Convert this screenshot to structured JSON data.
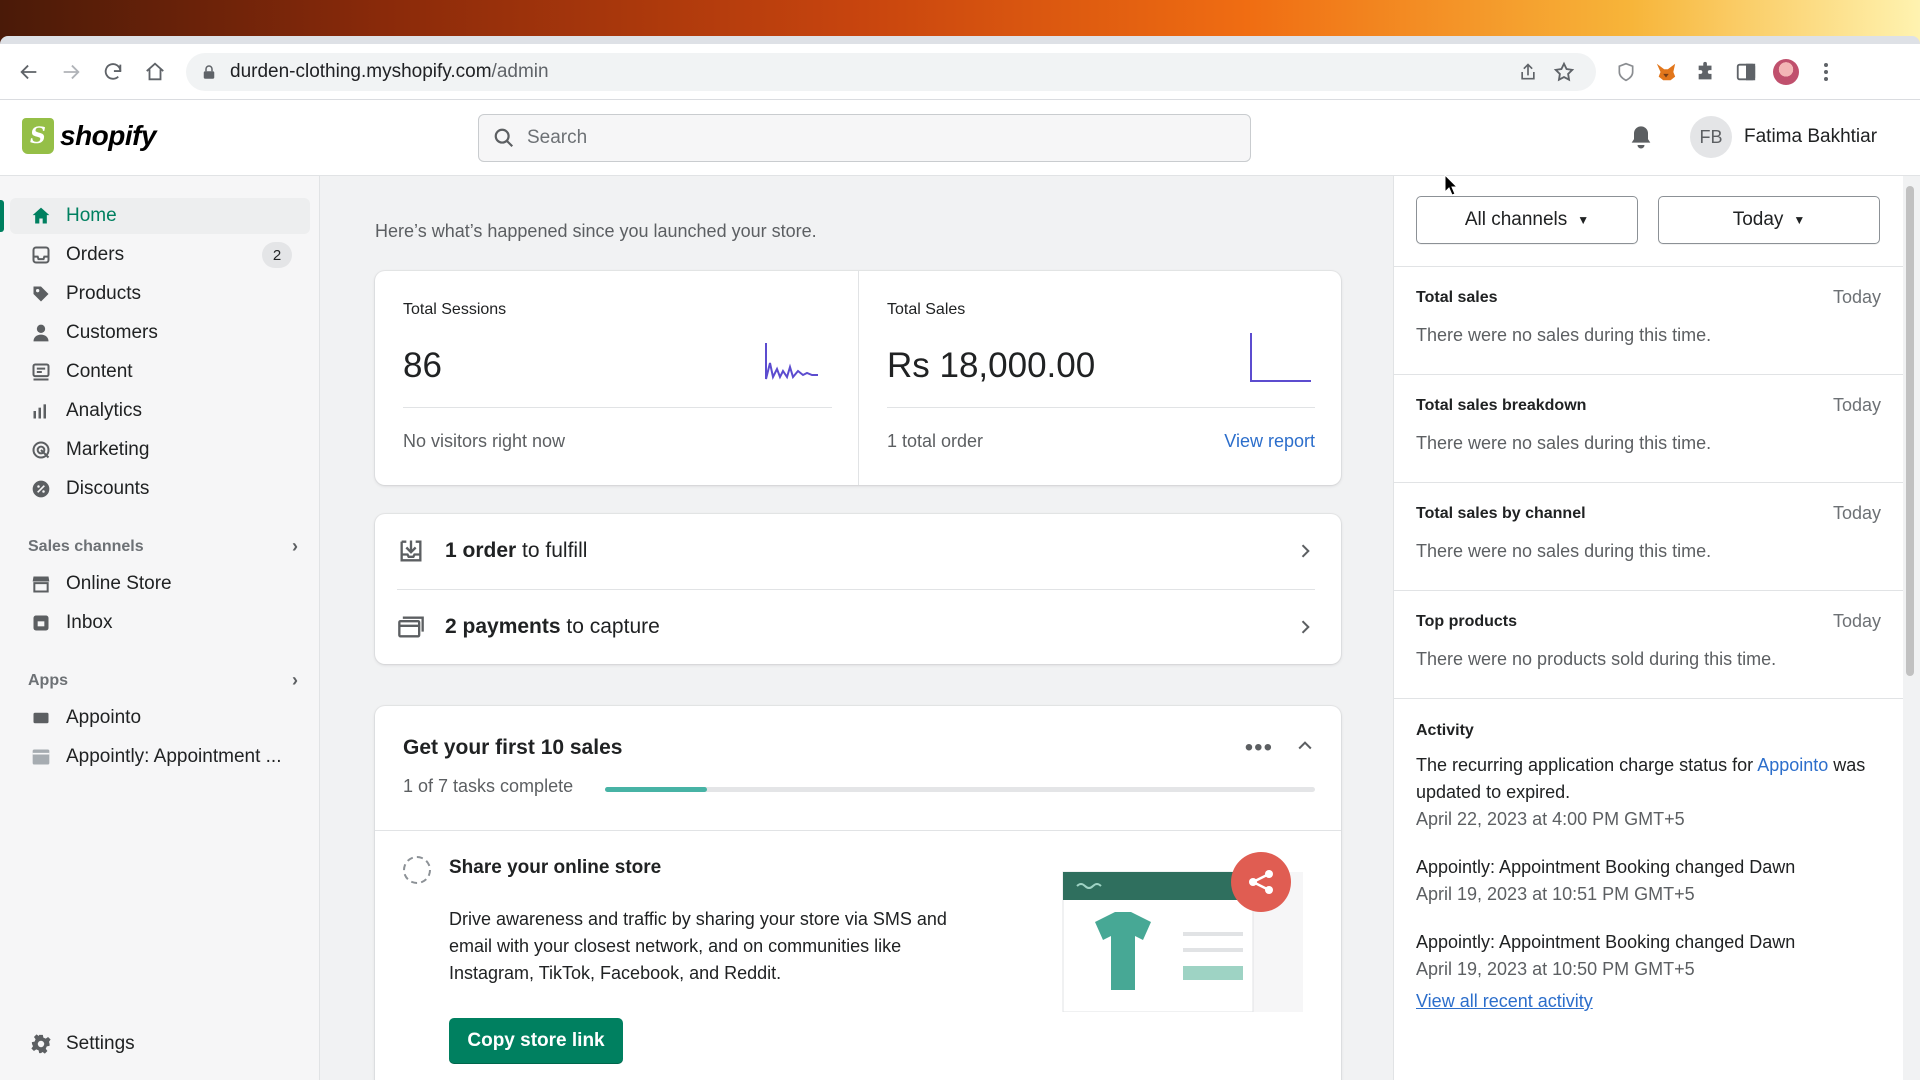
{
  "browser": {
    "url_host": "durden-clothing.myshopify.com",
    "url_path": "/admin",
    "icons": [
      "back-icon",
      "forward-icon",
      "reload-icon",
      "home-icon",
      "lock-icon",
      "share-icon",
      "star-icon",
      "shield-icon",
      "fox-icon",
      "puzzle-icon",
      "sidepanel-icon",
      "profile-icon",
      "menu-icon"
    ]
  },
  "topbar": {
    "logo_text": "shopify",
    "search_placeholder": "Search",
    "user_initials": "FB",
    "user_name": "Fatima Bakhtiar"
  },
  "sidebar": {
    "items": [
      {
        "label": "Home",
        "icon": "home-icon",
        "active": true
      },
      {
        "label": "Orders",
        "icon": "orders-icon",
        "badge": "2"
      },
      {
        "label": "Products",
        "icon": "tag-icon"
      },
      {
        "label": "Customers",
        "icon": "person-icon"
      },
      {
        "label": "Content",
        "icon": "content-icon"
      },
      {
        "label": "Analytics",
        "icon": "bar-chart-icon"
      },
      {
        "label": "Marketing",
        "icon": "target-icon"
      },
      {
        "label": "Discounts",
        "icon": "discount-icon"
      }
    ],
    "sales_channels_label": "Sales channels",
    "channels": [
      {
        "label": "Online Store",
        "icon": "store-icon"
      },
      {
        "label": "Inbox",
        "icon": "inbox-icon"
      }
    ],
    "apps_label": "Apps",
    "apps": [
      {
        "label": "Appointo",
        "icon": "app-icon"
      },
      {
        "label": "Appointly: Appointment ...",
        "icon": "calendar-icon"
      }
    ],
    "settings_label": "Settings"
  },
  "main": {
    "intro": "Here’s what’s happened since you launched your store.",
    "sessions": {
      "label": "Total Sessions",
      "value": "86",
      "footer": "No visitors right now"
    },
    "sales": {
      "label": "Total Sales",
      "value": "Rs 18,000.00",
      "footer": "1 total order",
      "link": "View report"
    },
    "tasks": [
      {
        "strong": "1 order",
        "rest": " to fulfill",
        "icon": "download-box-icon"
      },
      {
        "strong": "2 payments",
        "rest": " to capture",
        "icon": "credit-card-icon"
      }
    ],
    "setup": {
      "title": "Get your first 10 sales",
      "progress_text": "1 of 7 tasks complete",
      "progress_fraction": 0.143,
      "step_title": "Share your online store",
      "step_desc": "Drive awareness and traffic by sharing your store via SMS and email with your closest network, and on communities like Instagram, TikTok, Facebook, and Reddit.",
      "button": "Copy store link"
    }
  },
  "right": {
    "channel_filter": "All channels",
    "date_filter": "Today",
    "sections": [
      {
        "title": "Total sales",
        "date": "Today",
        "body": "There were no sales during this time."
      },
      {
        "title": "Total sales breakdown",
        "date": "Today",
        "body": "There were no sales during this time."
      },
      {
        "title": "Total sales by channel",
        "date": "Today",
        "body": "There were no sales during this time."
      },
      {
        "title": "Top products",
        "date": "Today",
        "body": "There were no products sold during this time."
      }
    ],
    "activity_title": "Activity",
    "activity": [
      {
        "pre": "The recurring application charge status for ",
        "link": "Appointo",
        "post": " was updated to expired.",
        "date": "April 22, 2023 at 4:00 PM GMT+5"
      },
      {
        "text": "Appointly: Appointment Booking changed Dawn",
        "date": "April 19, 2023 at 10:51 PM GMT+5"
      },
      {
        "text": "Appointly: Appointment Booking changed Dawn",
        "date": "April 19, 2023 at 10:50 PM GMT+5"
      }
    ],
    "view_all": "View all recent activity"
  },
  "colors": {
    "accent": "#008060",
    "link": "#2c6ecb",
    "chart": "#5c4ccf",
    "progress": "#47b3a5"
  }
}
